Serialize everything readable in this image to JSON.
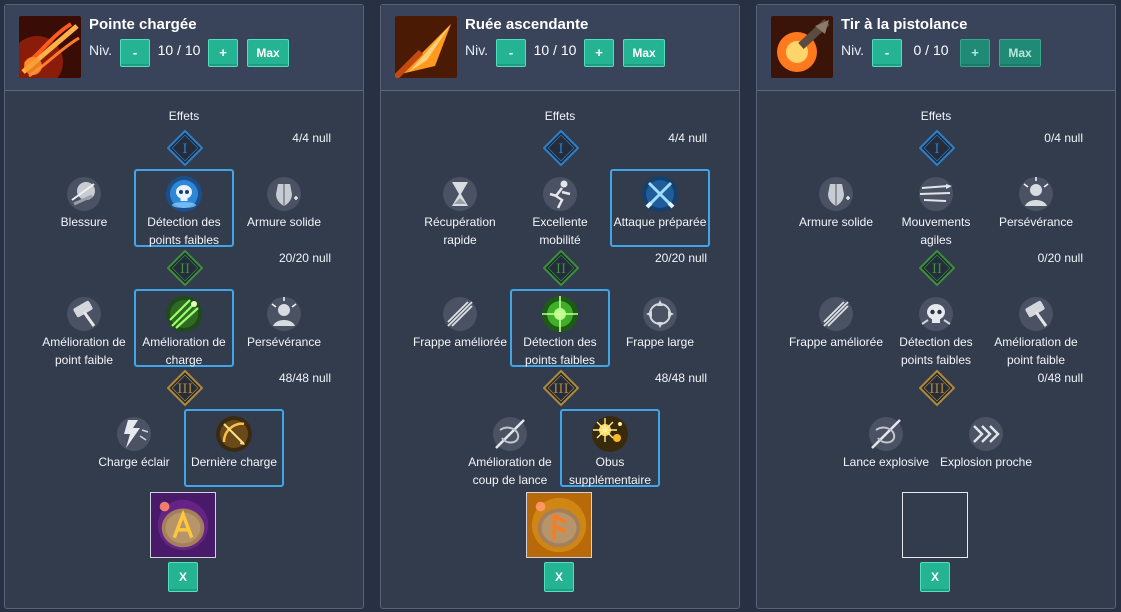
{
  "panels": [
    {
      "skill_name": "Pointe chargée",
      "icon": "spear-thrust-fire-icon",
      "level_label": "Niv.",
      "level_value": "10 / 10",
      "minus_label": "-",
      "plus_label": "+",
      "max_label": "Max",
      "effects_label": "Effets",
      "tiers": [
        {
          "numeral": "I",
          "count": "4/4 null",
          "nodes": [
            {
              "label_lines": [
                "Blessure"
              ],
              "icon": "wound-icon",
              "selected": false
            },
            {
              "label_lines": [
                "Détection des",
                "points faibles"
              ],
              "icon": "skull-target-icon",
              "selected": true
            },
            {
              "label_lines": [
                "Armure solide"
              ],
              "icon": "armor-shield-icon",
              "selected": false
            }
          ]
        },
        {
          "numeral": "II",
          "count": "20/20 null",
          "nodes": [
            {
              "label_lines": [
                "Amélioration de",
                "point faible"
              ],
              "icon": "weak-point-hammer-icon",
              "selected": false
            },
            {
              "label_lines": [
                "Amélioration de",
                "charge"
              ],
              "icon": "charge-streaks-icon",
              "selected": true
            },
            {
              "label_lines": [
                "Persévérance"
              ],
              "icon": "perseverance-icon",
              "selected": false
            }
          ]
        },
        {
          "numeral": "III",
          "count": "48/48 null",
          "nodes": [
            {
              "label_lines": [
                "Charge éclair"
              ],
              "icon": "lightning-charge-icon",
              "selected": false
            },
            {
              "label_lines": [
                "Dernière charge"
              ],
              "icon": "final-charge-bow-icon",
              "selected": true
            }
          ]
        }
      ],
      "rune": "purple-rune-icon",
      "x_label": "X",
      "is_max": true
    },
    {
      "skill_name": "Ruée ascendante",
      "icon": "rising-rush-icon",
      "level_label": "Niv.",
      "level_value": "10 / 10",
      "minus_label": "-",
      "plus_label": "+",
      "max_label": "Max",
      "effects_label": "Effets",
      "tiers": [
        {
          "numeral": "I",
          "count": "4/4 null",
          "nodes": [
            {
              "label_lines": [
                "Récupération",
                "rapide"
              ],
              "icon": "hourglass-icon",
              "selected": false
            },
            {
              "label_lines": [
                "Excellente",
                "mobilité"
              ],
              "icon": "running-figure-icon",
              "selected": false
            },
            {
              "label_lines": [
                "Attaque préparée"
              ],
              "icon": "crossed-swords-icon",
              "selected": true
            }
          ]
        },
        {
          "numeral": "II",
          "count": "20/20 null",
          "nodes": [
            {
              "label_lines": [
                "Frappe améliorée"
              ],
              "icon": "slash-strike-icon",
              "selected": false
            },
            {
              "label_lines": [
                "Détection des",
                "points faibles"
              ],
              "icon": "green-target-icon",
              "selected": true
            },
            {
              "label_lines": [
                "Frappe large"
              ],
              "icon": "wide-strike-icon",
              "selected": false
            }
          ]
        },
        {
          "numeral": "III",
          "count": "48/48 null",
          "nodes": [
            {
              "label_lines": [
                "Amélioration de",
                "coup de lance"
              ],
              "icon": "lance-swirl-icon",
              "selected": false
            },
            {
              "label_lines": [
                "Obus",
                "supplémentaire"
              ],
              "icon": "sparks-shell-icon",
              "selected": true
            }
          ]
        }
      ],
      "rune": "gold-rune-icon",
      "x_label": "X",
      "is_max": true
    },
    {
      "skill_name": "Tir à la pistolance",
      "icon": "gunlance-blast-icon",
      "level_label": "Niv.",
      "level_value": "0 / 10",
      "minus_label": "-",
      "plus_label": "+",
      "max_label": "Max",
      "effects_label": "Effets",
      "tiers": [
        {
          "numeral": "I",
          "count": "0/4 null",
          "nodes": [
            {
              "label_lines": [
                "Armure solide"
              ],
              "icon": "armor-shield-icon",
              "selected": false
            },
            {
              "label_lines": [
                "Mouvements",
                "agiles"
              ],
              "icon": "agile-wind-icon",
              "selected": false
            },
            {
              "label_lines": [
                "Persévérance"
              ],
              "icon": "perseverance-icon",
              "selected": false
            }
          ]
        },
        {
          "numeral": "II",
          "count": "0/20 null",
          "nodes": [
            {
              "label_lines": [
                "Frappe améliorée"
              ],
              "icon": "slash-strike-icon",
              "selected": false
            },
            {
              "label_lines": [
                "Détection des",
                "points faibles"
              ],
              "icon": "skull-target-icon",
              "selected": false
            },
            {
              "label_lines": [
                "Amélioration de",
                "point faible"
              ],
              "icon": "weak-point-hammer-icon",
              "selected": false
            }
          ]
        },
        {
          "numeral": "III",
          "count": "0/48 null",
          "nodes": [
            {
              "label_lines": [
                "Lance explosive"
              ],
              "icon": "lance-swirl-icon",
              "selected": false
            },
            {
              "label_lines": [
                "Explosion proche"
              ],
              "icon": "chevrons-icon",
              "selected": false
            }
          ]
        }
      ],
      "rune": "",
      "x_label": "X",
      "is_max": false
    }
  ],
  "colors": {
    "page_bg": "#283143",
    "panel_bg": "#333c4d",
    "accent_button": "#24b393",
    "selected_border": "#3fa6e8",
    "tier1": "#2f80c8",
    "tier2": "#3c8f3c",
    "tier3": "#b08a3a"
  }
}
